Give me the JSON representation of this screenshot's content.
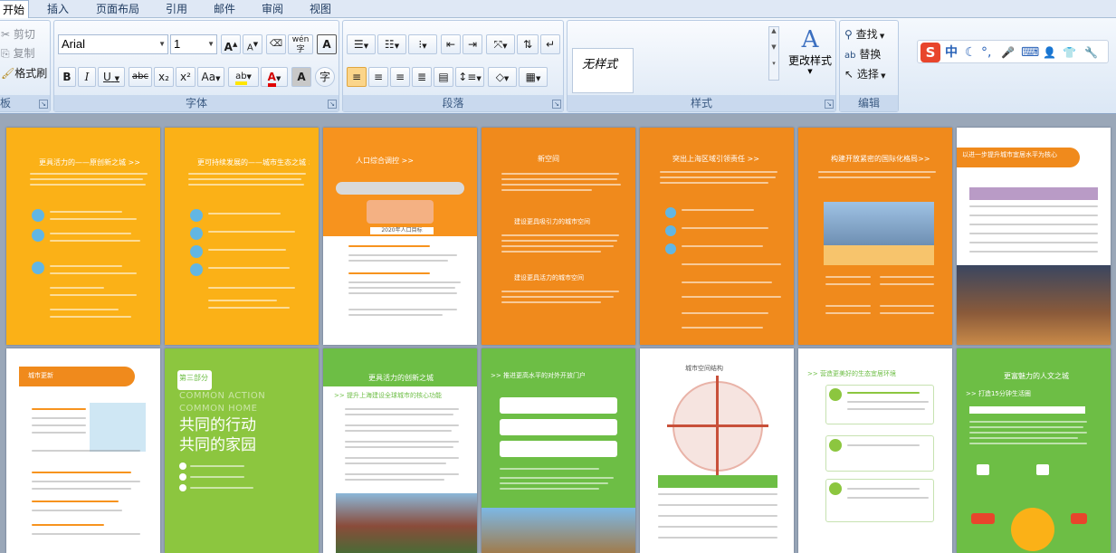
{
  "menubar": {
    "tabs": [
      {
        "label": "开始",
        "active": true
      },
      {
        "label": "插入"
      },
      {
        "label": "页面布局"
      },
      {
        "label": "引用"
      },
      {
        "label": "邮件"
      },
      {
        "label": "审阅"
      },
      {
        "label": "视图"
      }
    ]
  },
  "clipboard": {
    "cut": "剪切",
    "copy": "复制",
    "format_painter": "格式刷",
    "group_label": "板"
  },
  "font": {
    "family": "Arial",
    "size": "1",
    "grow": "A",
    "shrink": "A",
    "phonetic": "wén",
    "border_char": "A",
    "bold": "B",
    "italic": "I",
    "underline": "U",
    "strike": "abc",
    "subscript": "x₂",
    "superscript": "x²",
    "case": "Aa",
    "highlight": "ab",
    "font_color": "A",
    "shading": "A",
    "enclose": "字",
    "group_label": "字体"
  },
  "paragraph": {
    "group_label": "段落"
  },
  "styles": {
    "current": "无样式",
    "change_styles": "更改样式",
    "group_label": "样式"
  },
  "editing": {
    "find": "查找",
    "replace": "替换",
    "select": "选择",
    "group_label": "编辑"
  },
  "ime": {
    "logo": "S",
    "lang": "中",
    "moon": "☾",
    "punct": "°,",
    "mic": "🎤",
    "keyboard": "⌨",
    "user": "👤",
    "shirt": "👕",
    "wrench": "🔧"
  },
  "colors": {
    "orange": "#f7931e",
    "orange_dark": "#f08a1c",
    "yellow": "#fbb117",
    "green": "#6dbe45",
    "green_light": "#8cc63f",
    "ribbon_blue": "#dbe7f5"
  },
  "pages_row1": [
    {
      "title": "更具活力的——原创新之城 >>"
    },
    {
      "title": "更可持续发展的——城市生态之城 >>"
    },
    {
      "title": "人口综合调控 >>",
      "caption": "2020年人口目标"
    },
    {
      "title": "新空间",
      "sub1": "建设更具吸引力的城市空间",
      "sub2": "建设更具活力的城市空间"
    },
    {
      "title": "突出上海区域引领责任 >>"
    },
    {
      "title": "构建开放紧密的国际化格局>>"
    },
    {
      "title": "以进一步提升城市宜居水平为核心"
    }
  ],
  "pages_row2": [
    {
      "title": "城市更新"
    },
    {
      "part": "第三部分",
      "en1": "COMMON ACTION",
      "en2": "COMMON HOME",
      "cn1": "共同的行动",
      "cn2": "共同的家园"
    },
    {
      "title": "更具活力的创新之城",
      "sub": ">> 提升上海建设全球城市的核心功能"
    },
    {
      "title": ">> 推进更高水平的对外开放门户"
    },
    {
      "title": "城市空间结构"
    },
    {
      "title": ">> 营造更美好的生态宜居环境"
    },
    {
      "title": "更富魅力的人文之城",
      "sub": ">> 打造15分钟生活圈"
    }
  ]
}
